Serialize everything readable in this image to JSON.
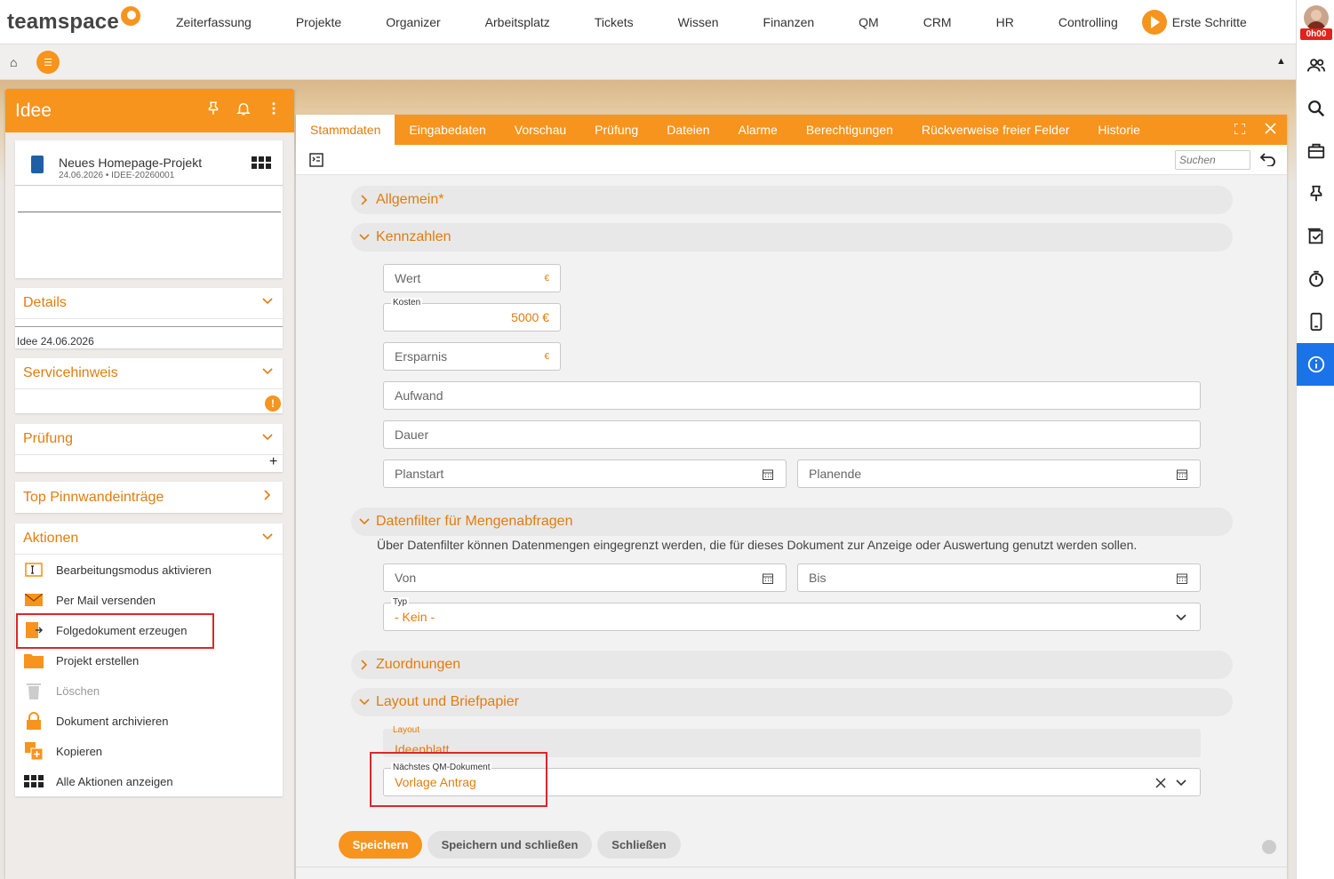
{
  "topnav": {
    "logo": "teamspace",
    "items": [
      "Zeiterfassung",
      "Projekte",
      "Organizer",
      "Arbeitsplatz",
      "Tickets",
      "Wissen",
      "Finanzen",
      "QM",
      "CRM",
      "HR",
      "Controlling"
    ],
    "first_steps": "Erste Schritte",
    "timer": "0h00"
  },
  "leftpanel": {
    "title": "Idee",
    "doc": {
      "name": "Neues Homepage-Projekt",
      "meta": "24.06.2026 • IDEE-20260001"
    },
    "details": {
      "title": "Details",
      "content": "Idee 24.06.2026"
    },
    "servicehinweis": {
      "title": "Servicehinweis"
    },
    "pruefung": {
      "title": "Prüfung"
    },
    "pinnwand": {
      "title": "Top Pinnwandeinträge"
    },
    "aktionen": {
      "title": "Aktionen",
      "items": [
        "Bearbeitungsmodus aktivieren",
        "Per Mail versenden",
        "Folgedokument erzeugen",
        "Projekt erstellen",
        "Löschen",
        "Dokument archivieren",
        "Kopieren",
        "Alle Aktionen anzeigen"
      ]
    }
  },
  "main": {
    "tabs": [
      "Stammdaten",
      "Eingabedaten",
      "Vorschau",
      "Prüfung",
      "Dateien",
      "Alarme",
      "Berechtigungen",
      "Rückverweise freier Felder",
      "Historie"
    ],
    "search_placeholder": "Suchen",
    "sections": {
      "allgemein": "Allgemein*",
      "kennzahlen": "Kennzahlen",
      "datenfilter": "Datenfilter für Mengenabfragen",
      "zuordnungen": "Zuordnungen",
      "layout": "Layout und Briefpapier"
    },
    "fields": {
      "wert": "Wert",
      "kosten_label": "Kosten",
      "kosten_value": "5000 €",
      "ersparnis": "Ersparnis",
      "aufwand": "Aufwand",
      "dauer": "Dauer",
      "planstart": "Planstart",
      "planende": "Planende",
      "von": "Von",
      "bis": "Bis",
      "typ_label": "Typ",
      "typ_value": "- Kein -",
      "layout_label": "Layout",
      "layout_value": "Ideenblatt",
      "qm_label": "Nächstes QM-Dokument",
      "qm_value": "Vorlage Antrag",
      "euro": "€"
    },
    "datenfilter_desc": "Über Datenfilter können Datenmengen eingegrenzt werden, die für dieses Dokument zur Anzeige oder Auswertung genutzt werden sollen.",
    "buttons": {
      "save": "Speichern",
      "save_close": "Speichern und schließen",
      "close": "Schließen"
    }
  },
  "colors": {
    "accent": "#f7941d",
    "accent_text": "#e07d0f",
    "highlight": "#d9282b",
    "active_blue": "#1a73e8"
  }
}
